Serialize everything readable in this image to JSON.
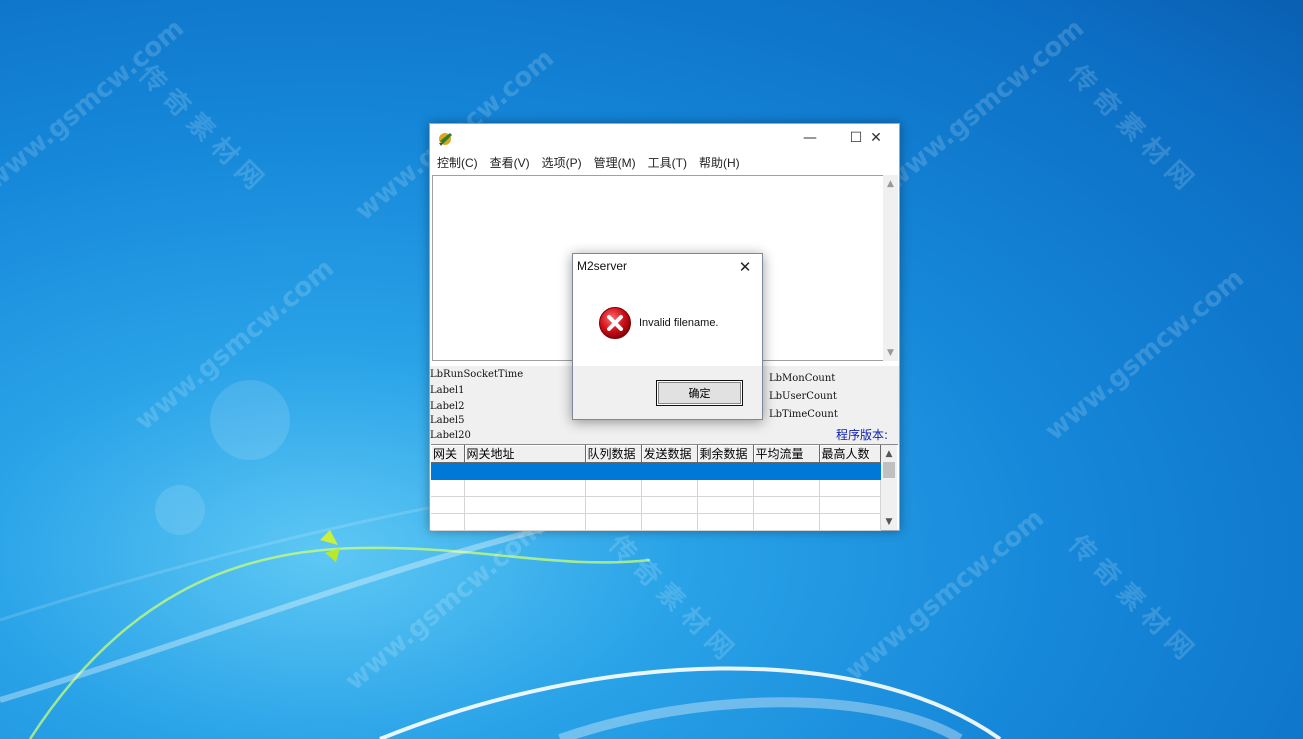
{
  "watermark": {
    "en": "www.gsmcw.com",
    "cn": "传奇素材网"
  },
  "app": {
    "menu": [
      {
        "label": "控制(C)"
      },
      {
        "label": "查看(V)"
      },
      {
        "label": "选项(P)"
      },
      {
        "label": "管理(M)"
      },
      {
        "label": "工具(T)"
      },
      {
        "label": "帮助(H)"
      }
    ],
    "status_labels_left": [
      "LbRunSocketTime",
      "Label1",
      "Label2",
      "Label5",
      "Label20"
    ],
    "status_labels_right": [
      "LbMonCount",
      "LbUserCount",
      "LbTimeCount"
    ],
    "version_label": "程序版本:",
    "table": {
      "columns": [
        "网关",
        "网关地址",
        "队列数据",
        "发送数据",
        "剩余数据",
        "平均流量",
        "最高人数"
      ],
      "rows": [
        {
          "selected": true,
          "cells": [
            "",
            "",
            "",
            "",
            "",
            "",
            ""
          ]
        },
        {
          "selected": false,
          "cells": [
            "",
            "",
            "",
            "",
            "",
            "",
            ""
          ]
        },
        {
          "selected": false,
          "cells": [
            "",
            "",
            "",
            "",
            "",
            "",
            ""
          ]
        },
        {
          "selected": false,
          "cells": [
            "",
            "",
            "",
            "",
            "",
            "",
            ""
          ]
        }
      ]
    },
    "window_buttons": {
      "minimize": "—",
      "maximize": "☐",
      "close": "✕"
    }
  },
  "dialog": {
    "title": "M2server",
    "message": "Invalid filename.",
    "ok_label": "确定",
    "close_glyph": "✕"
  },
  "colors": {
    "selection": "#0078d7",
    "version_text": "#1020b0",
    "error_red": "#d0101a"
  },
  "icons": {
    "app": "app-logo-icon",
    "error": "error-icon"
  }
}
